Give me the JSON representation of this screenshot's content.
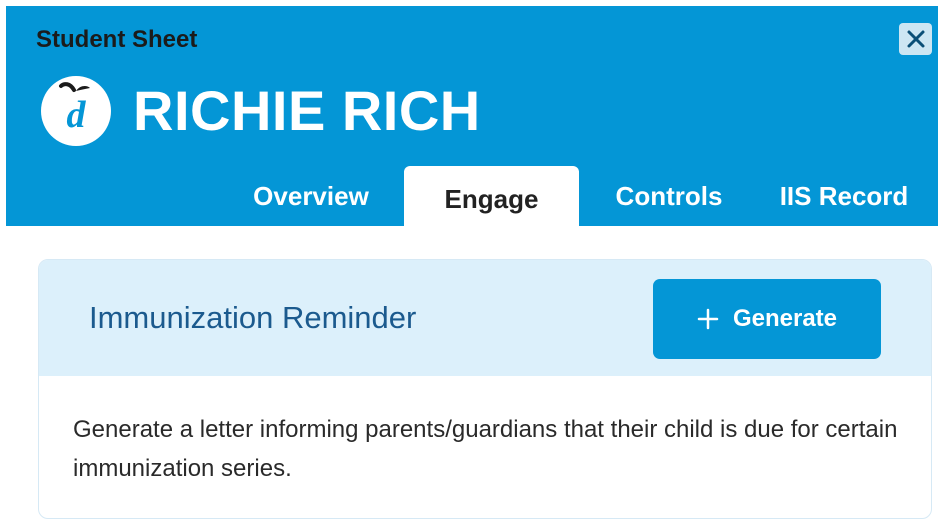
{
  "header": {
    "sheet_label": "Student Sheet",
    "student_name": "RICHIE RICH",
    "close_icon": "close-icon",
    "logo_icon": "apple-d-logo-icon"
  },
  "tabs": [
    {
      "label": "Overview",
      "active": false
    },
    {
      "label": "Engage",
      "active": true
    },
    {
      "label": "Controls",
      "active": false
    },
    {
      "label": "IIS Record",
      "active": false
    }
  ],
  "card": {
    "title": "Immunization Reminder",
    "generate_label": "Generate",
    "generate_icon": "plus-icon",
    "description": "Generate a letter informing parents/guardians that their child is due for certain immunization series."
  },
  "colors": {
    "brand_blue": "#0496d6",
    "card_header_bg": "#dcf0fb",
    "card_title": "#1b5a8e"
  }
}
